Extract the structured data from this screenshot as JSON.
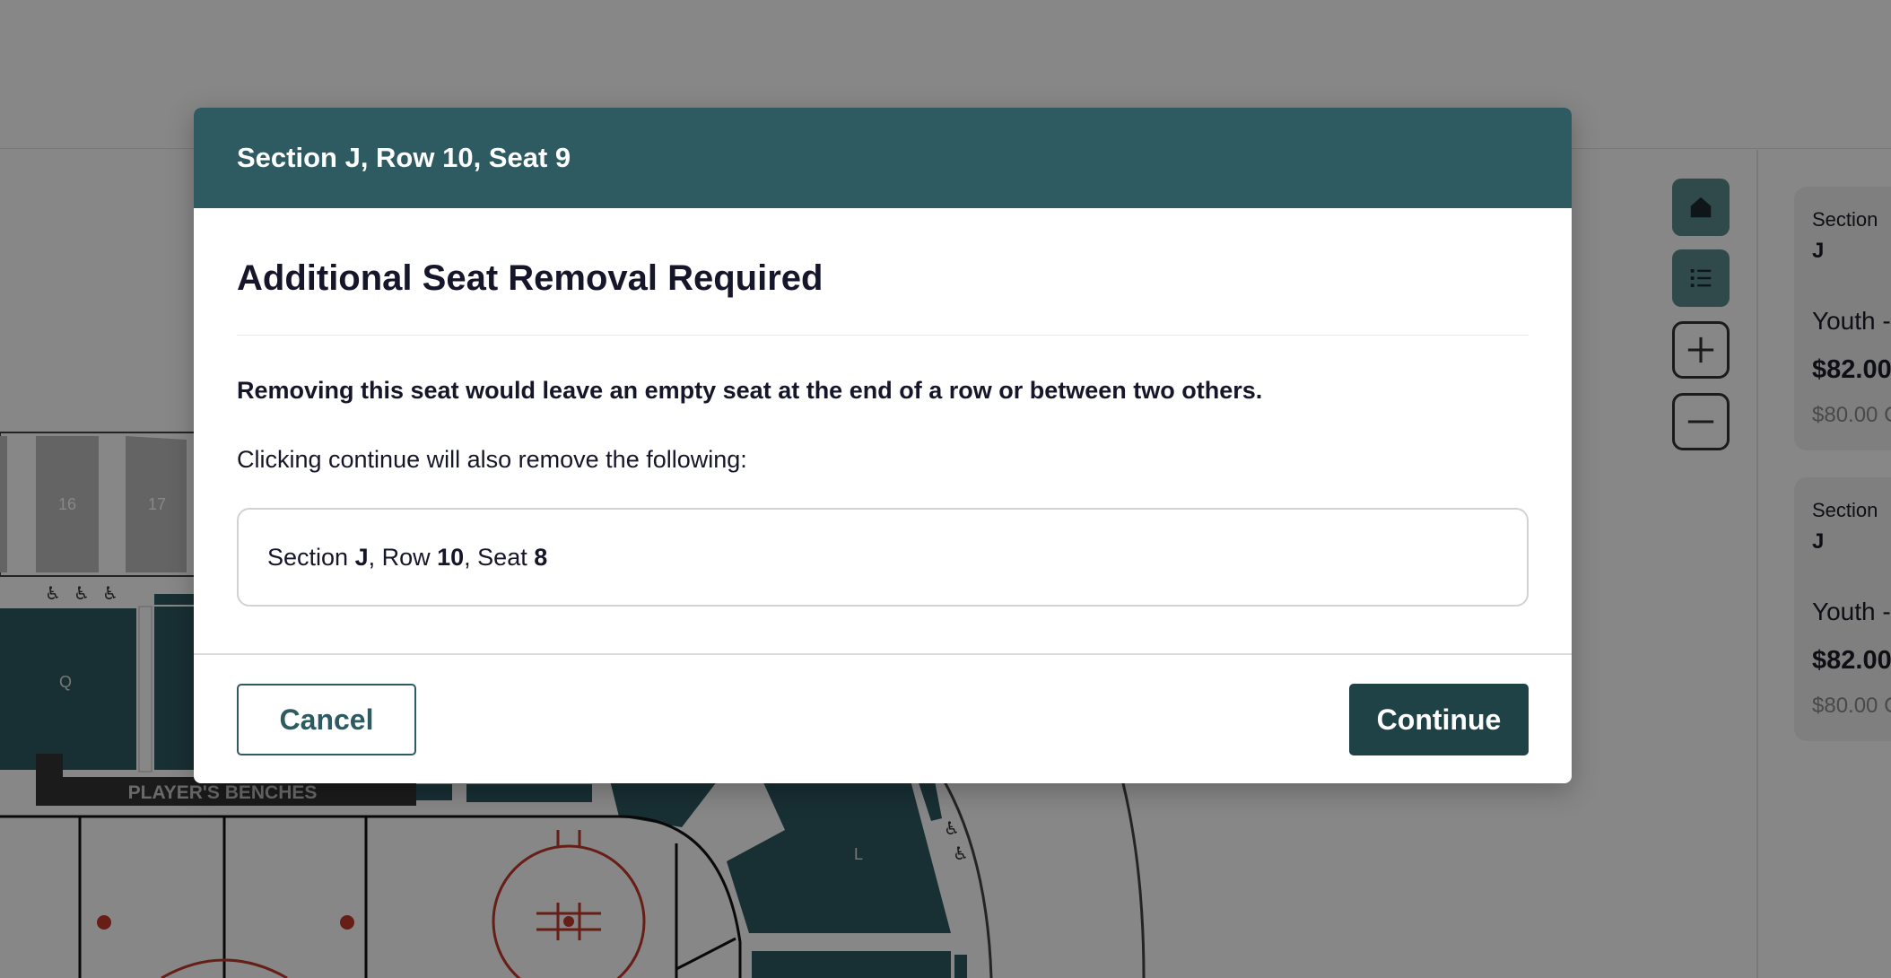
{
  "modal": {
    "header": "Section J, Row 10, Seat 9",
    "title": "Additional Seat Removal Required",
    "warning": "Removing this seat would leave an empty seat at the end of a row or between two others.",
    "info": "Clicking continue will also remove the following:",
    "removal_item": {
      "section_label": "Section ",
      "section": "J",
      "row_label": ", Row ",
      "row": "10",
      "seat_label": ", Seat ",
      "seat": "8"
    },
    "cancel_label": "Cancel",
    "continue_label": "Continue"
  },
  "map": {
    "section_labels": [
      "16",
      "17",
      "Q",
      "L"
    ],
    "benches_label": "PLAYER'S BENCHES",
    "controls": [
      "home-icon",
      "list-icon",
      "zoom-in-icon",
      "zoom-out-icon"
    ]
  },
  "cart": {
    "cards": [
      {
        "label": "Section",
        "section": "J",
        "ticket_type": "Youth -",
        "price": "$82.00",
        "sub": "$80.00 C"
      },
      {
        "label": "Section",
        "section": "J",
        "ticket_type": "Youth -",
        "price": "$82.00",
        "sub": "$80.00 C"
      }
    ]
  },
  "colors": {
    "header": "#2e5a61",
    "primary_button": "#1e4246",
    "seat_teal": "#2e5a61",
    "rink_red": "#c0392b"
  }
}
